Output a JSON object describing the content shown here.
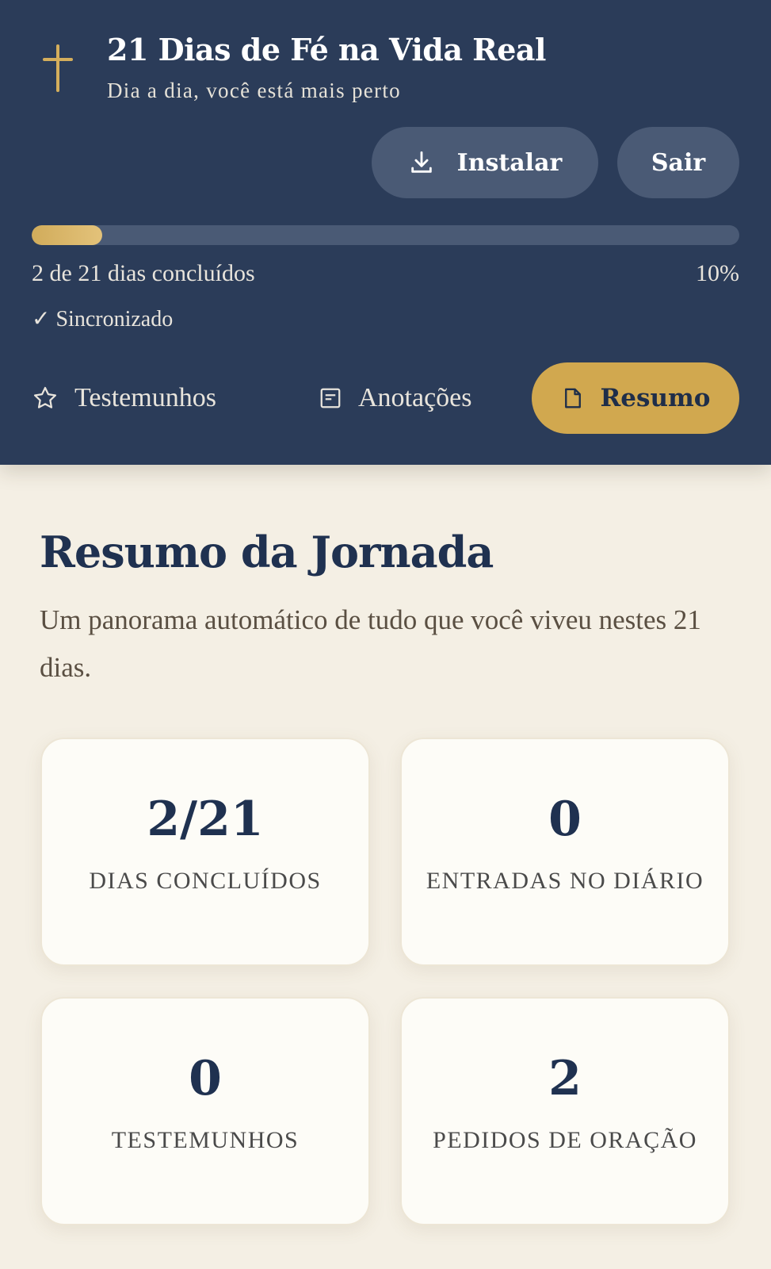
{
  "header": {
    "title": "21 Dias de Fé na Vida Real",
    "subtitle": "Dia a dia, você está mais perto",
    "install_label": "Instalar",
    "exit_label": "Sair",
    "icons": {
      "logo": "cross-icon",
      "install": "download-icon"
    }
  },
  "progress": {
    "fraction": 0.1,
    "summary": "2 de 21 dias concluídos",
    "percent_label": "10%",
    "sync_label": "✓ Sincronizado"
  },
  "nav": {
    "items": [
      {
        "label": "Testemunhos",
        "icon": "star-icon",
        "active": false
      },
      {
        "label": "Anotações",
        "icon": "note-icon",
        "active": false
      },
      {
        "label": "Resumo",
        "icon": "document-icon",
        "active": true
      }
    ]
  },
  "summary": {
    "title": "Resumo da Jornada",
    "description": "Um panorama automático de tudo que você viveu nestes 21 dias.",
    "stats": [
      {
        "value": "2/21",
        "label": "DIAS CONCLUÍDOS"
      },
      {
        "value": "0",
        "label": "ENTRADAS NO DIÁRIO"
      },
      {
        "value": "0",
        "label": "TESTEMUNHOS"
      },
      {
        "value": "2",
        "label": "PEDIDOS DE ORAÇÃO"
      }
    ]
  },
  "colors": {
    "header_bg": "#2b3c59",
    "accent_gold": "#d1a84f",
    "page_bg": "#f4efe4",
    "card_bg": "#fdfcf7",
    "text_navy": "#1f3150"
  }
}
